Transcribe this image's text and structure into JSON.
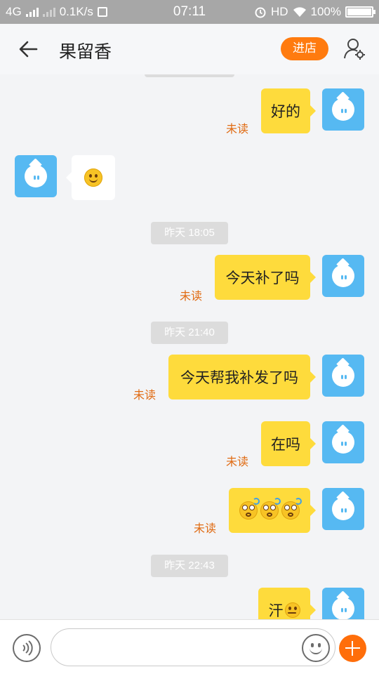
{
  "status_bar": {
    "network": "4G",
    "speed": "0.1K/s",
    "time": "07:11",
    "hd": "HD",
    "battery": "100%",
    "battery_level": 1.0
  },
  "header": {
    "title": "果留香",
    "shop_button": "进店",
    "back_icon": "arrow-left-icon",
    "user_icon": "user-settings-icon"
  },
  "messages": [
    {
      "text": "好的",
      "unread": "未读"
    },
    {
      "emoji": "smile"
    },
    {
      "timestamp": "昨天 18:05"
    },
    {
      "text": "今天补了吗",
      "unread": "未读"
    },
    {
      "timestamp": "昨天 21:40"
    },
    {
      "text": "今天帮我补发了吗",
      "unread": "未读"
    },
    {
      "text": "在吗",
      "unread": "未读"
    },
    {
      "emoji": "dizzy x3",
      "unread": "未读"
    },
    {
      "timestamp": "昨天 22:43"
    },
    {
      "text": "汗"
    }
  ],
  "composer": {
    "voice_icon": "voice-icon",
    "emoji_icon": "emoji-icon",
    "plus_icon": "plus-icon"
  },
  "colors": {
    "accent": "#ff7b0f",
    "my_bubble": "#fedb3c",
    "avatar": "#56b9f2",
    "unread": "#e06b13"
  }
}
